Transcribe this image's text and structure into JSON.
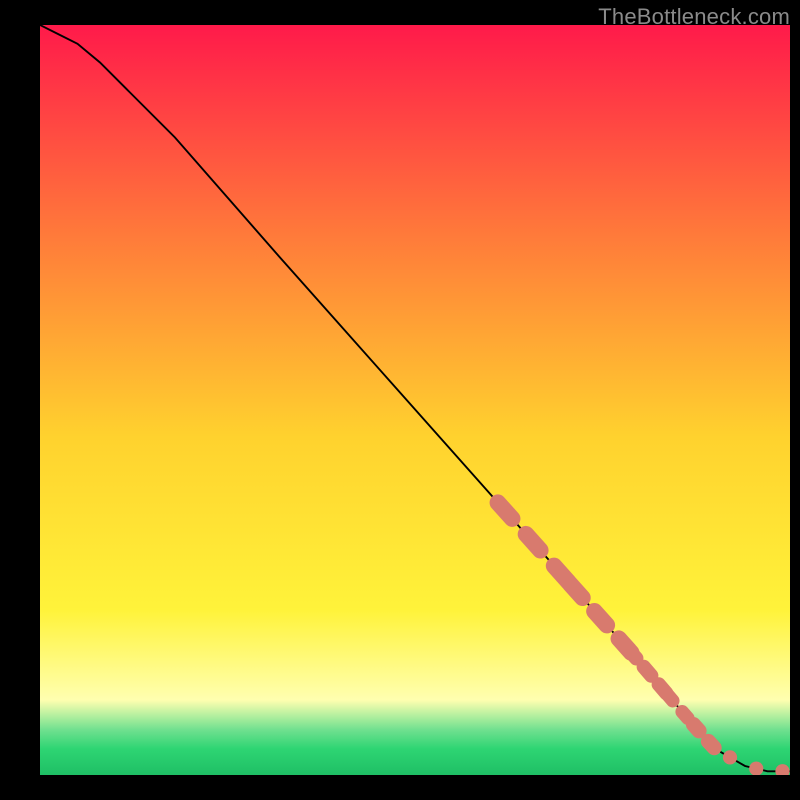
{
  "watermark": "TheBottleneck.com",
  "colors": {
    "top": "#ff1a4a",
    "mid_upper": "#ff7a3a",
    "mid": "#ffd22e",
    "mid_lower": "#fff33a",
    "pale_yellow": "#ffffb0",
    "green_top": "#6fe08f",
    "green_mid": "#2ed573",
    "green_bottom": "#1fbf65",
    "curve": "#000000",
    "dot_fill": "#d87a6e",
    "dot_stroke": "#c8675a"
  },
  "chart_data": {
    "type": "line",
    "title": "",
    "xlabel": "",
    "ylabel": "",
    "xlim": [
      0,
      100
    ],
    "ylim": [
      0,
      100
    ],
    "series": [
      {
        "name": "curve",
        "x": [
          0,
          2,
          5,
          8,
          12,
          18,
          25,
          32,
          40,
          48,
          56,
          64,
          72,
          80,
          86,
          90,
          94,
          97,
          100
        ],
        "y": [
          100,
          99,
          97.5,
          95,
          91,
          85,
          77,
          69,
          60,
          51,
          42,
          33,
          24,
          15,
          8,
          3.5,
          1.2,
          0.5,
          0.5
        ]
      }
    ],
    "dot_clusters": [
      {
        "start_x": 62,
        "end_x": 69.5,
        "n": 3,
        "radius": 1.1
      },
      {
        "start_x": 71.5,
        "end_x": 78,
        "n": 3,
        "radius": 1.1
      },
      {
        "start_x": 79,
        "end_x": 83,
        "n": 3,
        "radius": 0.95
      },
      {
        "start_x": 84,
        "end_x": 86,
        "n": 2,
        "radius": 0.9
      },
      {
        "start_x": 87.5,
        "end_x": 89.5,
        "n": 2,
        "radius": 1.0
      }
    ],
    "tail_dots_x": [
      92,
      95.5,
      99
    ],
    "tail_dot_radius": 0.95
  }
}
